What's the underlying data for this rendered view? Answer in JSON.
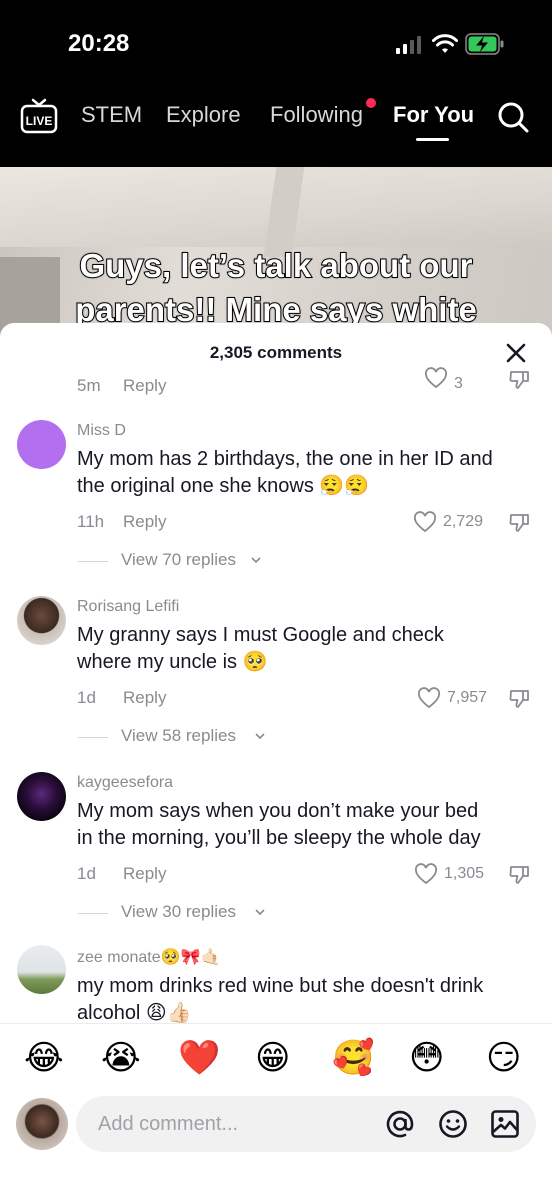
{
  "status_bar": {
    "time": "20:28",
    "signal_icon": "signal-icon",
    "wifi_icon": "wifi-icon",
    "battery_icon": "battery-charging-icon"
  },
  "nav": {
    "live_label": "LIVE",
    "tabs": [
      {
        "label": "STEM",
        "active": false
      },
      {
        "label": "Explore",
        "active": false
      },
      {
        "label": "Following",
        "active": false,
        "has_dot": true
      },
      {
        "label": "For You",
        "active": true
      }
    ],
    "search_icon": "search-icon"
  },
  "video": {
    "caption_line1": "Guys, let’s talk about our",
    "caption_line2": "parents!! Mine says white"
  },
  "comments_sheet": {
    "title": "2,305 comments",
    "close_icon": "close-icon",
    "partial_row": {
      "time": "5m",
      "reply": "Reply",
      "likes": "3"
    },
    "comments": [
      {
        "username": "Miss D",
        "text_line1": "My mom has 2 birthdays, the one in her ID and",
        "text_line2": "the original one she knows 😮‍💨😮‍💨",
        "time": "11h",
        "reply": "Reply",
        "likes": "2,729",
        "view_replies": "View 70 replies",
        "avatar_color": "#b36ff0"
      },
      {
        "username": "Rorisang Lefifi",
        "text_line1": "My granny says I must Google and check",
        "text_line2": "where my uncle is 🥺",
        "time": "1d",
        "reply": "Reply",
        "likes": "7,957",
        "view_replies": "View 58 replies"
      },
      {
        "username": "kaygeesefora",
        "text_line1": "My mom says when you don’t make your bed",
        "text_line2": "in the morning, you’ll be sleepy the whole day",
        "time": "1d",
        "reply": "Reply",
        "likes": "1,305",
        "view_replies": "View 30 replies"
      },
      {
        "username": "zee monate🥺🎀🤙🏻",
        "text_line1": "my mom drinks red wine but she doesn't drink",
        "text_line2": "alcohol 😩👍🏻"
      }
    ]
  },
  "quick_emojis": [
    "😂",
    "😭",
    "❤️",
    "😁",
    "🥰",
    "😳",
    "😏"
  ],
  "comment_input": {
    "placeholder": "Add comment..."
  },
  "accent_colors": {
    "notification_dot": "#fe2c55",
    "battery_green": "#34c759",
    "text_primary": "#161823",
    "text_secondary": "#8a8b91"
  }
}
